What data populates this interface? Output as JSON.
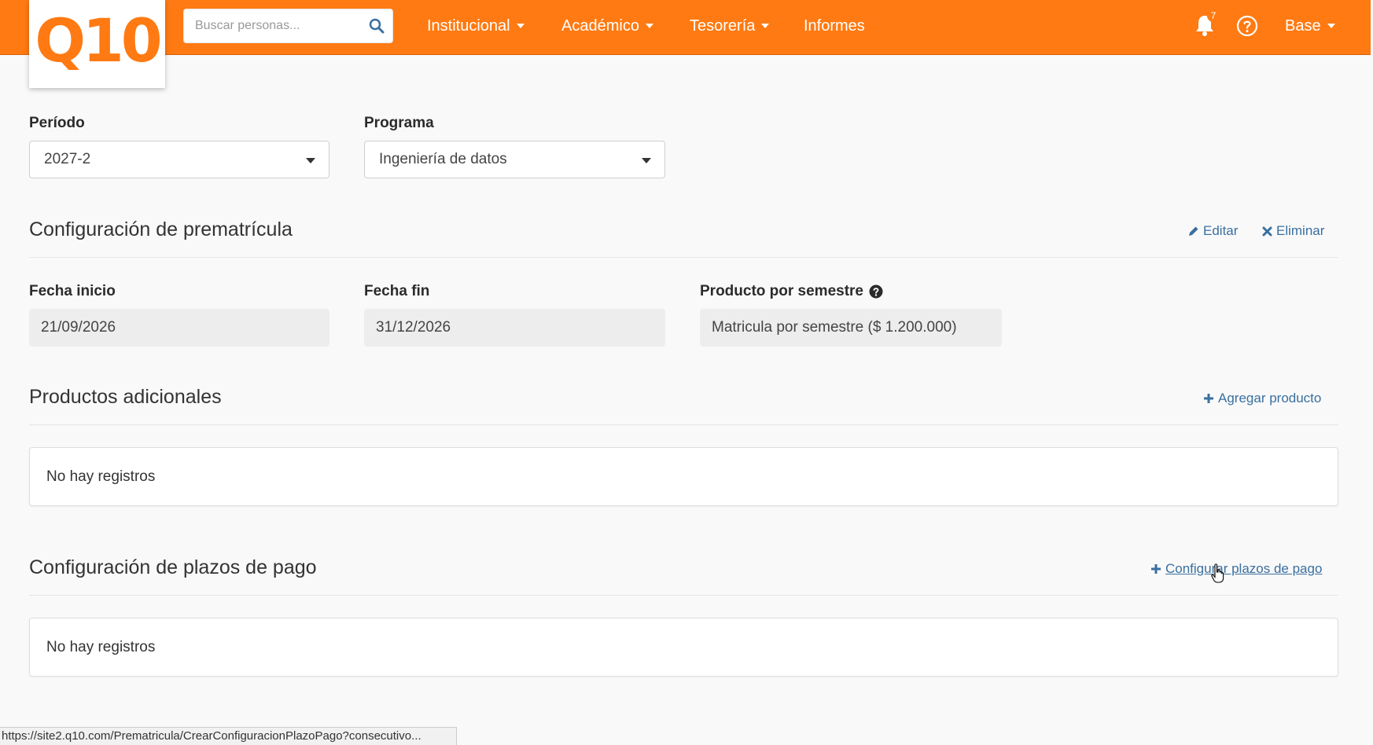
{
  "header": {
    "logo_text": "Q10",
    "search_placeholder": "Buscar personas...",
    "menu": [
      {
        "label": "Institucional",
        "dropdown": true
      },
      {
        "label": "Académico",
        "dropdown": true
      },
      {
        "label": "Tesorería",
        "dropdown": true
      },
      {
        "label": "Informes",
        "dropdown": false
      }
    ],
    "notifications_count": "7",
    "user_menu": "Base",
    "bar_color": "#ff7a12"
  },
  "filters": {
    "period_label": "Período",
    "period_value": "2027-2",
    "program_label": "Programa",
    "program_value": "Ingeniería de datos"
  },
  "prematricula": {
    "title": "Configuración de prematrícula",
    "edit_label": "Editar",
    "delete_label": "Eliminar",
    "start_date_label": "Fecha inicio",
    "start_date_value": "21/09/2026",
    "end_date_label": "Fecha fin",
    "end_date_value": "31/12/2026",
    "product_label": "Producto por semestre",
    "product_value": "Matricula por semestre ($ 1.200.000)"
  },
  "additional_products": {
    "title": "Productos adicionales",
    "add_label": "Agregar producto",
    "empty_text": "No hay registros"
  },
  "payment_terms": {
    "title": "Configuración de plazos de pago",
    "configure_label": "Configurar plazos de pago",
    "empty_text": "No hay registros"
  },
  "status_url": "https://site2.q10.com/Prematricula/CrearConfiguracionPlazoPago?consecutivo..."
}
